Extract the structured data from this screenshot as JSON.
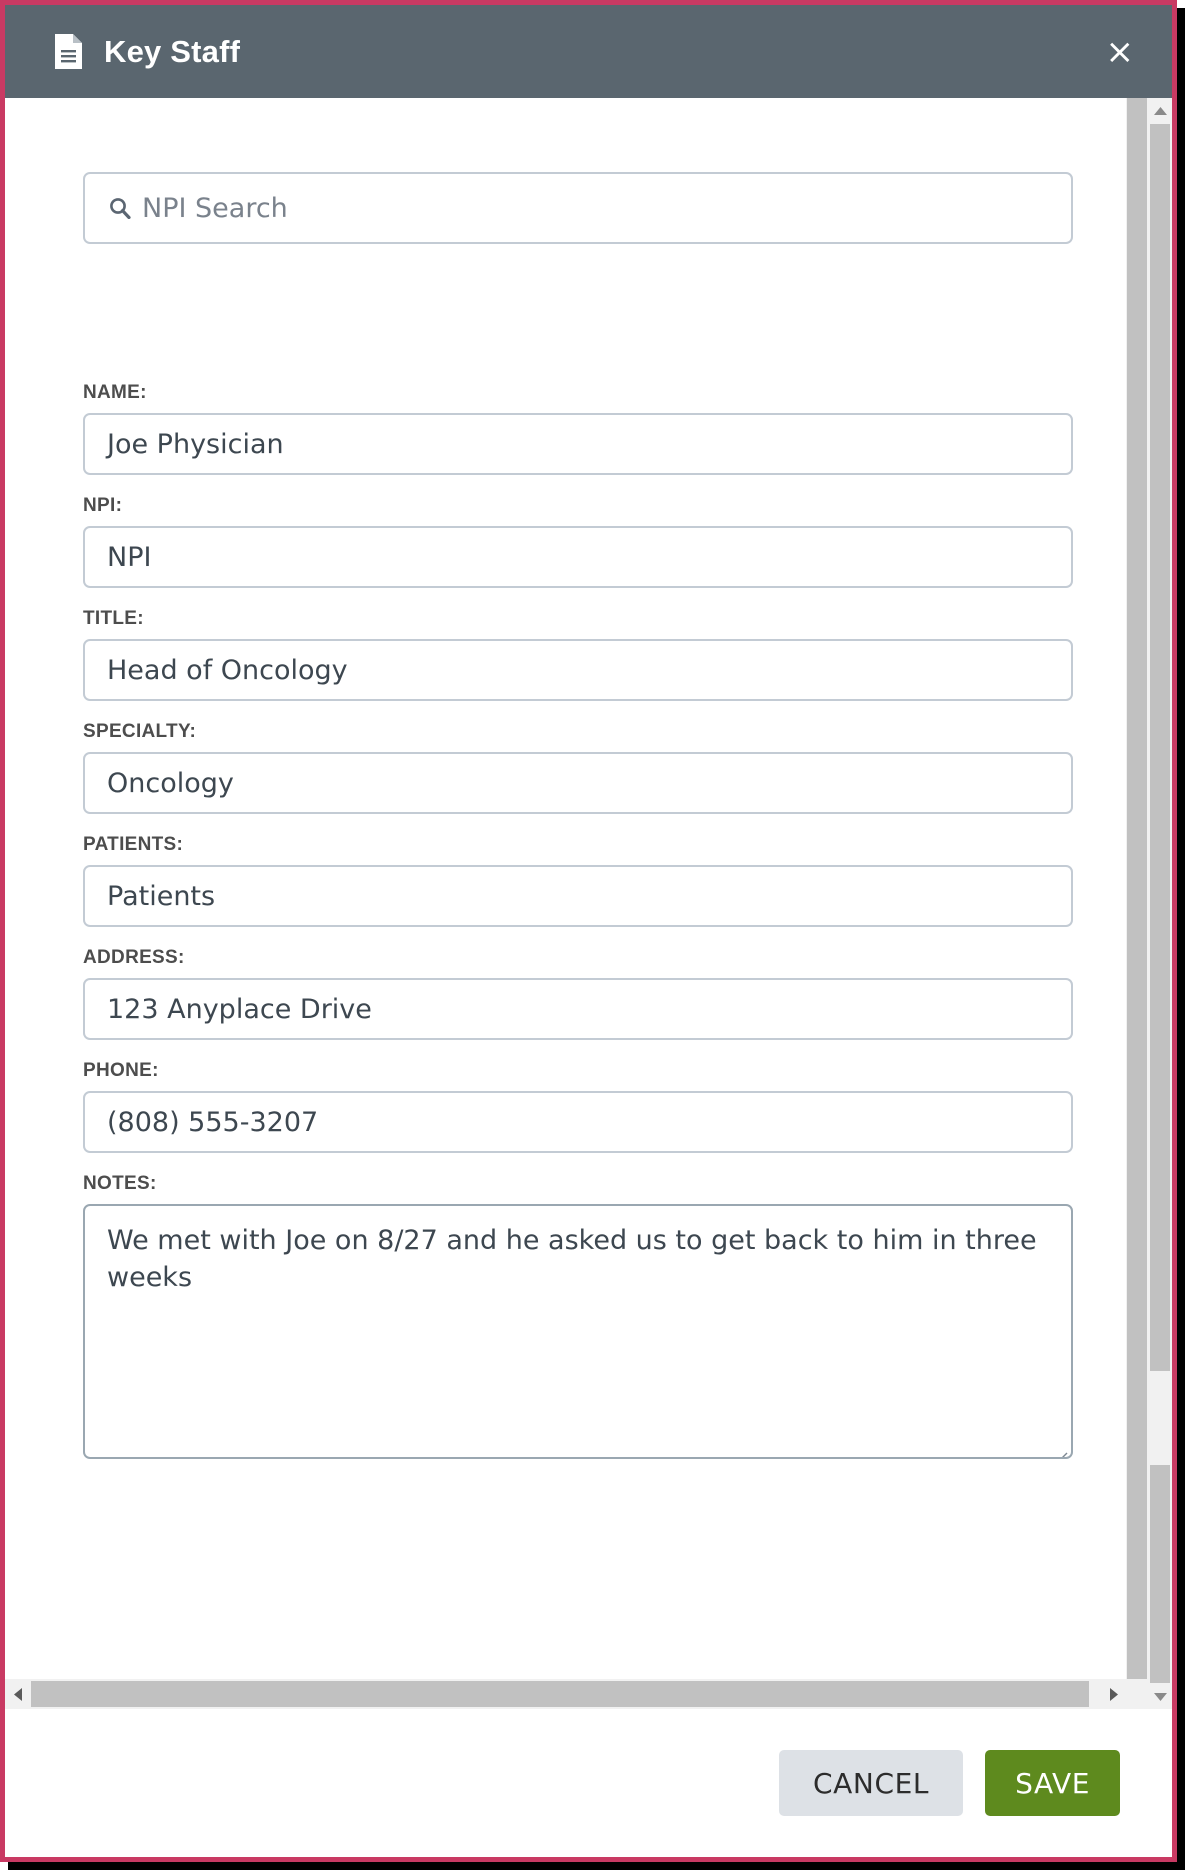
{
  "window": {
    "border_color": "#c93a63",
    "header_bg": "#5a666f"
  },
  "header": {
    "icon": "document-icon",
    "title": "Key Staff",
    "close_label": "×"
  },
  "search": {
    "icon": "search-icon",
    "placeholder": "NPI Search",
    "value": ""
  },
  "form": {
    "fields": [
      {
        "label": "NAME:",
        "value": "Joe Physician"
      },
      {
        "label": "NPI:",
        "value": "NPI"
      },
      {
        "label": "TITLE:",
        "value": "Head of Oncology"
      },
      {
        "label": "SPECIALTY:",
        "value": "Oncology"
      },
      {
        "label": "PATIENTS:",
        "value": "Patients"
      },
      {
        "label": "ADDRESS:",
        "value": "123 Anyplace Drive"
      },
      {
        "label": "PHONE:",
        "value": "(808) 555-3207"
      }
    ],
    "notes": {
      "label": "NOTES:",
      "value": "We met with Joe on 8/27 and he asked us to get back to him in three weeks"
    }
  },
  "footer": {
    "cancel_label": "CANCEL",
    "save_label": "SAVE",
    "save_color": "#5e8a1e",
    "cancel_color": "#dde1e6"
  }
}
